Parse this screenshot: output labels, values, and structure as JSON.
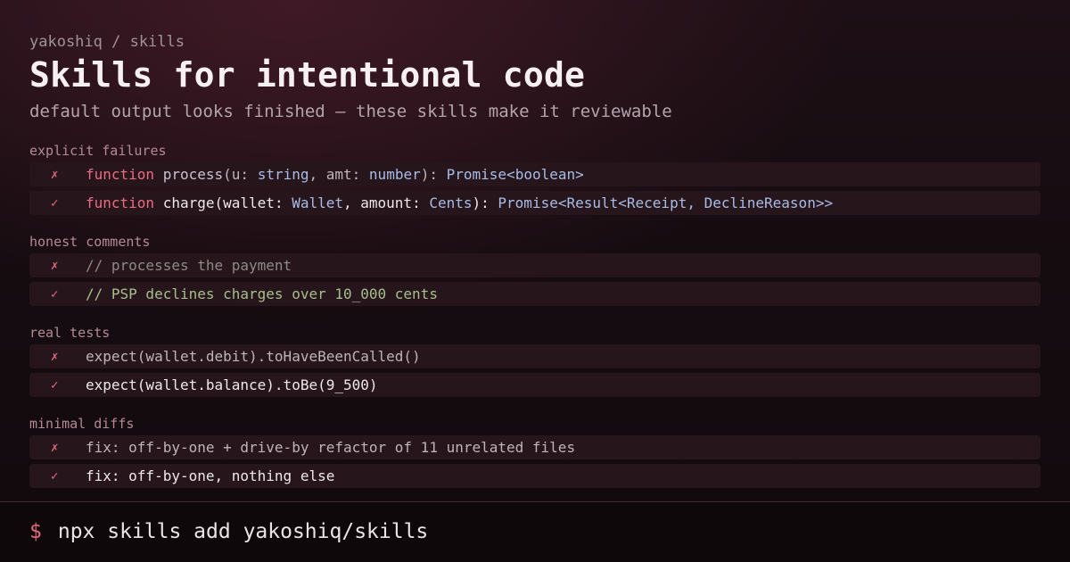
{
  "header": {
    "breadcrumb": "yakoshiq / skills",
    "title": "Skills for intentional code",
    "subtitle": "default output looks finished — these skills make it reviewable"
  },
  "marks": {
    "bad": "✗",
    "good": "✓"
  },
  "sections": [
    {
      "label": "explicit failures",
      "bad": {
        "keyword": "function",
        "name": "process",
        "open": "(",
        "p1": "u",
        "colon1": ": ",
        "t1": "string",
        "sep": ", ",
        "p2": "amt",
        "colon2": ": ",
        "t2": "number",
        "close": "): ",
        "ret": "Promise<boolean>"
      },
      "good": {
        "keyword": "function",
        "name": "charge",
        "open": "(",
        "p1": "wallet",
        "colon1": ": ",
        "t1": "Wallet",
        "sep": ", ",
        "p2": "amount",
        "colon2": ": ",
        "t2": "Cents",
        "close": "): ",
        "ret": "Promise<Result<Receipt, DeclineReason>>"
      }
    },
    {
      "label": "honest comments",
      "bad": "// processes the payment",
      "good": "// PSP declines charges over 10_000 cents"
    },
    {
      "label": "real tests",
      "bad": "expect(wallet.debit).toHaveBeenCalled()",
      "good": "expect(wallet.balance).toBe(9_500)"
    },
    {
      "label": "minimal diffs",
      "bad": "fix: off-by-one + drive-by refactor of 11 unrelated files",
      "good": "fix: off-by-one, nothing else"
    }
  ],
  "footer": {
    "prompt_symbol": "$",
    "command": "npx skills add yakoshiq/skills"
  },
  "colors": {
    "accent": "#e5697f",
    "type": "#a9bce6",
    "comment_good": "#a6bf8c",
    "background": "#140c10"
  }
}
